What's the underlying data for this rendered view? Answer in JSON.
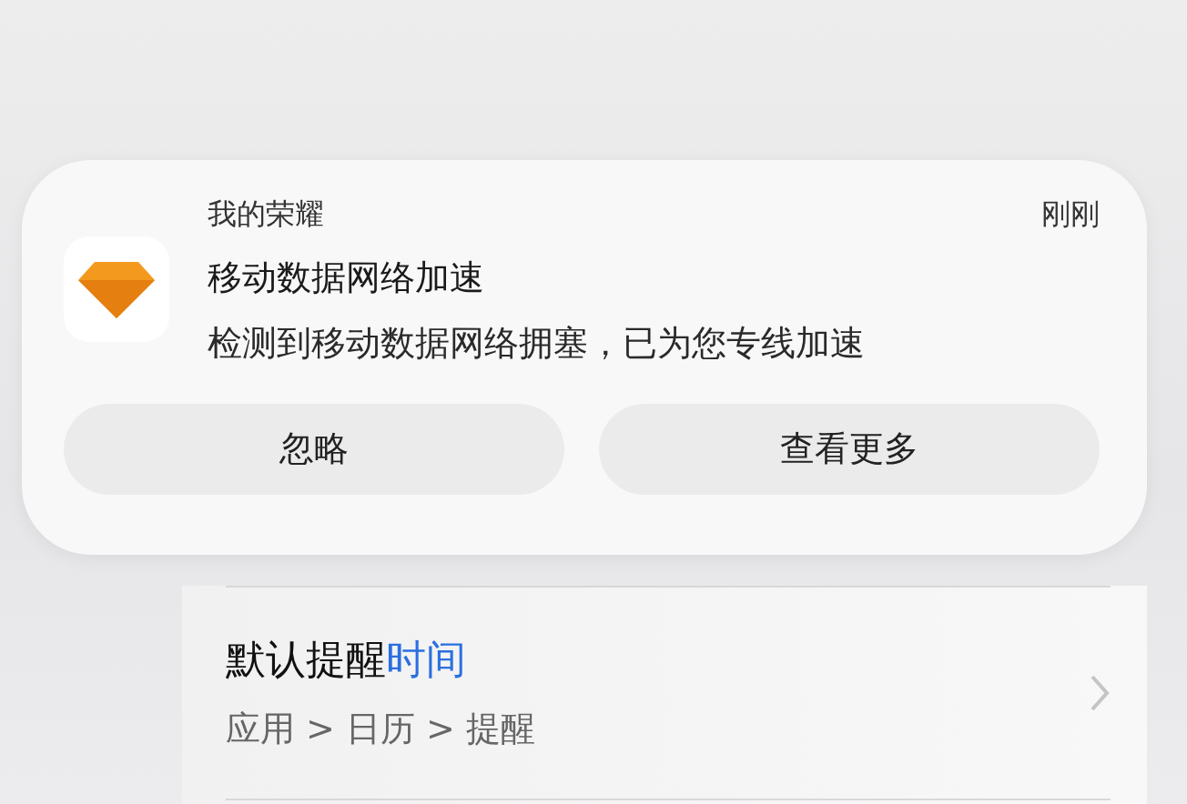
{
  "notification": {
    "app_name": "我的荣耀",
    "time": "刚刚",
    "title": "移动数据网络加速",
    "body": "检测到移动数据网络拥塞，已为您专线加速",
    "buttons": [
      "忽略",
      "查看更多"
    ]
  },
  "setting_item": {
    "title": "默认提醒",
    "title_highlight": "时间",
    "path": "应用 > 日历 > 提醒"
  }
}
